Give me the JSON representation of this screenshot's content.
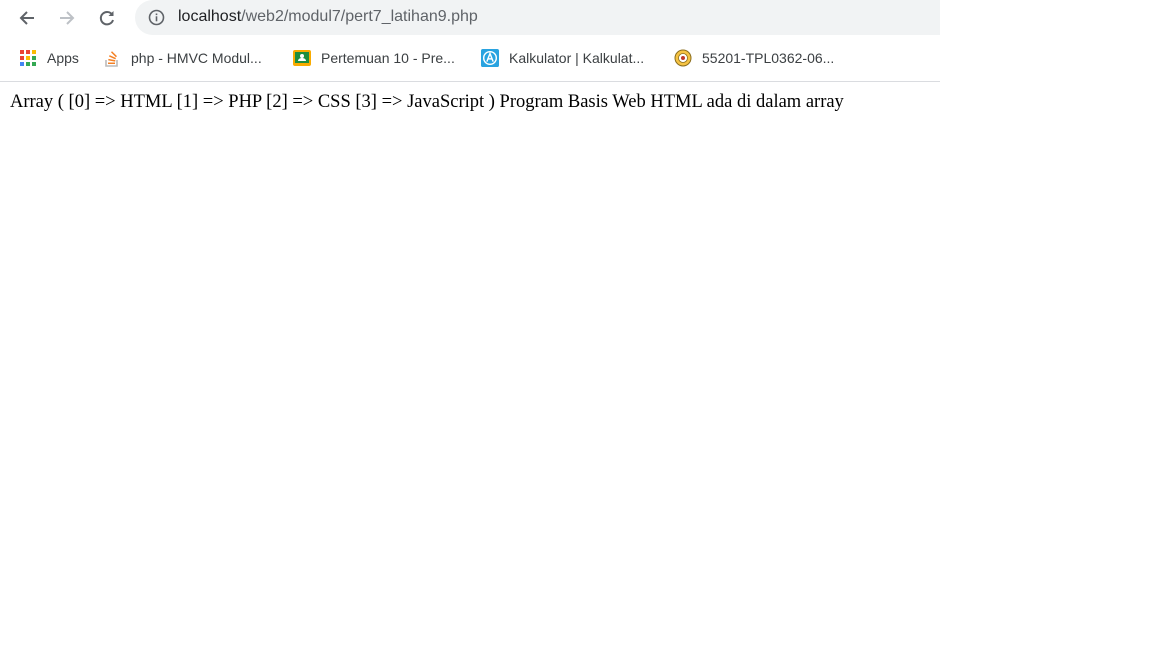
{
  "browser": {
    "address_bar": {
      "host": "localhost",
      "path": "/web2/modul7/pert7_latihan9.php"
    },
    "bookmarks": [
      {
        "label": "Apps",
        "icon": "apps-grid-icon"
      },
      {
        "label": "php - HMVC Modul...",
        "icon": "stackoverflow-icon"
      },
      {
        "label": "Pertemuan 10 - Pre...",
        "icon": "classroom-icon"
      },
      {
        "label": "Kalkulator | Kalkulat...",
        "icon": "kalkulator-icon"
      },
      {
        "label": "55201-TPL0362-06...",
        "icon": "university-icon"
      }
    ]
  },
  "page": {
    "output_text": "Array ( [0] => HTML [1] => PHP [2] => CSS [3] => JavaScript ) Program Basis Web HTML ada di dalam array"
  }
}
